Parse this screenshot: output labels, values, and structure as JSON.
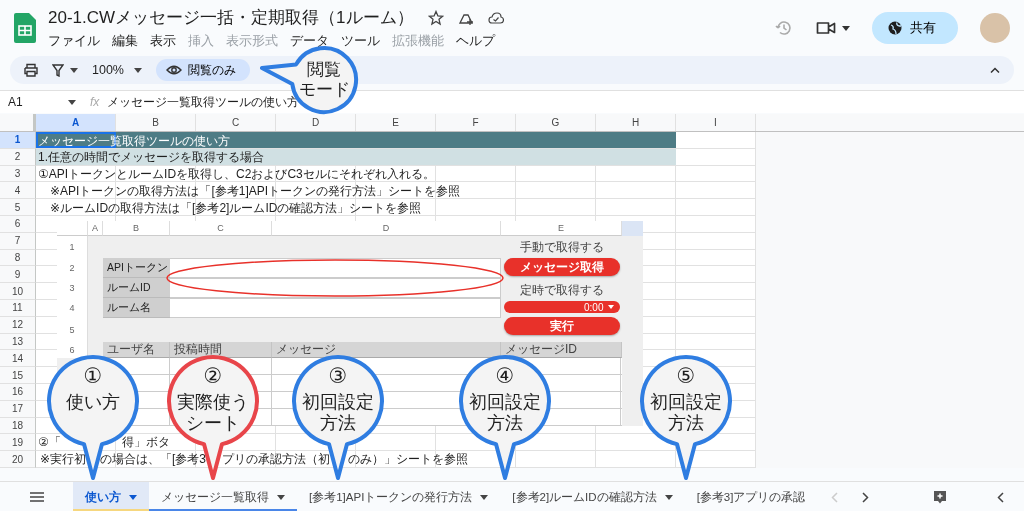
{
  "title": "20-1.CWメッセージ一括・定期取得（1ルーム）",
  "menu": [
    {
      "label": "ファイル",
      "disabled": false
    },
    {
      "label": "編集",
      "disabled": false
    },
    {
      "label": "表示",
      "disabled": false
    },
    {
      "label": "挿入",
      "disabled": true
    },
    {
      "label": "表示形式",
      "disabled": true
    },
    {
      "label": "データ",
      "disabled": false
    },
    {
      "label": "ツール",
      "disabled": false
    },
    {
      "label": "拡張機能",
      "disabled": true
    },
    {
      "label": "ヘルプ",
      "disabled": false
    }
  ],
  "share_button": "共有",
  "toolbar": {
    "zoom": "100%",
    "mode": "閲覧のみ"
  },
  "name_box": "A1",
  "fx_label": "fx",
  "formula": "メッセージ一覧取得ツールの使い方",
  "columns": [
    {
      "label": "A",
      "selected": true
    },
    {
      "label": "B",
      "selected": false
    },
    {
      "label": "C",
      "selected": false
    },
    {
      "label": "D",
      "selected": false
    },
    {
      "label": "E",
      "selected": false
    },
    {
      "label": "F",
      "selected": false
    },
    {
      "label": "G",
      "selected": false
    },
    {
      "label": "H",
      "selected": false
    },
    {
      "label": "I",
      "selected": false
    }
  ],
  "rows": [
    {
      "number": "1",
      "selected": true,
      "kind": "title",
      "text": "メッセージ一覧取得ツールの使い方"
    },
    {
      "number": "2",
      "selected": false,
      "kind": "heading",
      "text": "1.任意の時間でメッセージを取得する場合"
    },
    {
      "number": "3",
      "selected": false,
      "kind": "plain",
      "text": "①APIトークンとルームIDを取得し、C2およびC3セルにそれぞれ入れる。"
    },
    {
      "number": "4",
      "selected": false,
      "kind": "note",
      "text": "※APIトークンの取得方法は「[参考1]APIトークンの発行方法」シートを参照"
    },
    {
      "number": "5",
      "selected": false,
      "kind": "note",
      "text": "※ルームIDの取得方法は「[参考2]ルームIDの確認方法」シートを参照"
    },
    {
      "number": "6",
      "selected": false,
      "kind": "empty"
    },
    {
      "number": "7",
      "selected": false,
      "kind": "empty"
    },
    {
      "number": "8",
      "selected": false,
      "kind": "empty"
    },
    {
      "number": "9",
      "selected": false,
      "kind": "empty"
    },
    {
      "number": "10",
      "selected": false,
      "kind": "empty"
    },
    {
      "number": "11",
      "selected": false,
      "kind": "empty"
    },
    {
      "number": "12",
      "selected": false,
      "kind": "empty"
    },
    {
      "number": "13",
      "selected": false,
      "kind": "empty"
    },
    {
      "number": "14",
      "selected": false,
      "kind": "empty"
    },
    {
      "number": "15",
      "selected": false,
      "kind": "empty"
    },
    {
      "number": "16",
      "selected": false,
      "kind": "empty"
    },
    {
      "number": "17",
      "selected": false,
      "kind": "empty"
    },
    {
      "number": "18",
      "selected": false,
      "kind": "empty"
    },
    {
      "number": "19",
      "selected": false,
      "kind": "segments",
      "segments": [
        "②「",
        "得」ボタ"
      ]
    },
    {
      "number": "20",
      "selected": false,
      "kind": "segments",
      "segments": [
        "※実行初",
        "の場合は、「[参考3",
        "プリの承認方法（初",
        "のみ）」シートを参照"
      ]
    }
  ],
  "embedded_sheet": {
    "columns": [
      "A",
      "B",
      "C",
      "D",
      "E"
    ],
    "row_numbers": [
      "1",
      "2",
      "3",
      "4",
      "5",
      "6"
    ],
    "labels": [
      "APIトークン",
      "ルームID",
      "ルーム名"
    ],
    "manual_label": "手動で取得する",
    "fetch_button": "メッセージ取得",
    "scheduled_label": "定時で取得する",
    "time_select": "0:00",
    "run_button": "実行",
    "table_headers": [
      "ユーザ名",
      "投稿時間",
      "メッセージ",
      "メッセージID"
    ]
  },
  "sheet_tabs": [
    {
      "label": "使い方",
      "selected": true,
      "dropdown": true,
      "color": "#f6d77f"
    },
    {
      "label": "メッセージ一覧取得",
      "selected": false,
      "dropdown": true,
      "color": "#4a86e8"
    },
    {
      "label": "[参考1]APIトークンの発行方法",
      "selected": false,
      "dropdown": true
    },
    {
      "label": "[参考2]ルームIDの確認方法",
      "selected": false,
      "dropdown": true
    },
    {
      "label": "[参考3]アプリの承認",
      "selected": false,
      "dropdown": false
    }
  ],
  "mode_callout": {
    "lines": [
      "閲覧",
      "モード"
    ],
    "color": "#2f7de1"
  },
  "callouts": [
    {
      "number": "①",
      "lines": [
        "使い方"
      ],
      "color": "#2f7de1"
    },
    {
      "number": "②",
      "lines": [
        "実際使う",
        "シート"
      ],
      "color": "#e8454a"
    },
    {
      "number": "③",
      "lines": [
        "初回設定",
        "方法"
      ],
      "color": "#2f7de1"
    },
    {
      "number": "④",
      "lines": [
        "初回設定",
        "方法"
      ],
      "color": "#2f7de1"
    },
    {
      "number": "⑤",
      "lines": [
        "初回設定",
        "方法"
      ],
      "color": "#2f7de1"
    }
  ]
}
